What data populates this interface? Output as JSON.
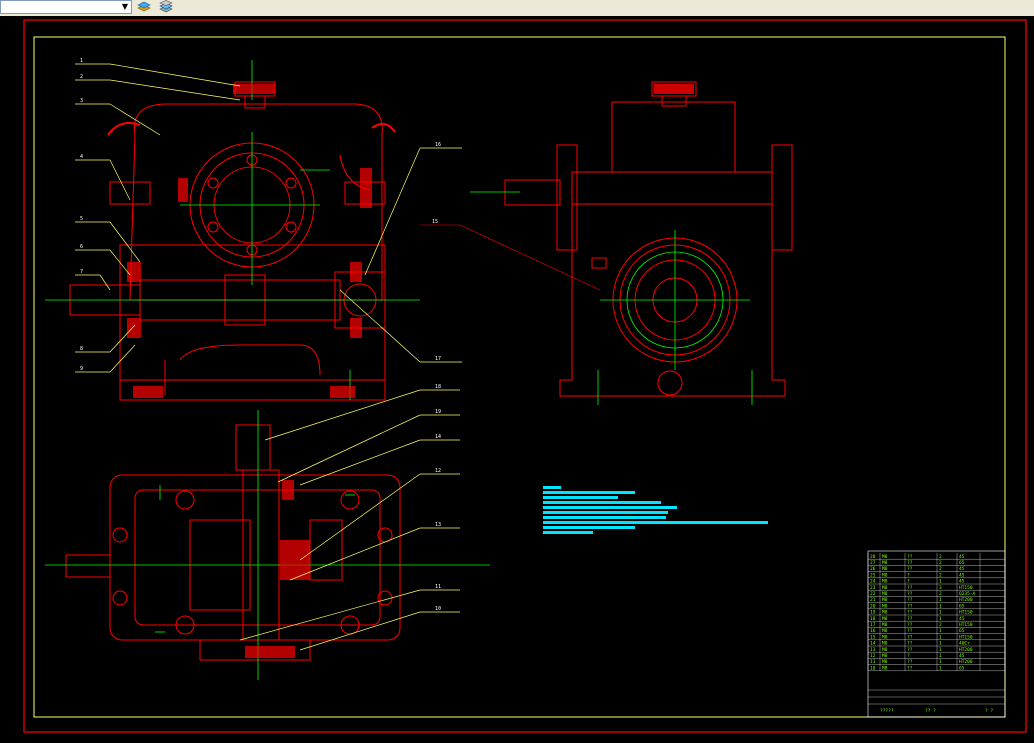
{
  "toolbar": {
    "layer_combo_value": "",
    "icons": [
      "layer-stack-icon",
      "layer-properties-icon"
    ]
  },
  "drawing": {
    "leaders_left": [
      "1",
      "2",
      "3",
      "4",
      "5",
      "6",
      "7",
      "8",
      "9"
    ],
    "leaders_right_top": [
      "16",
      "17"
    ],
    "leader_side_view": "15",
    "leaders_bottom": [
      "18",
      "19",
      "14",
      "12",
      "13",
      "11",
      "10"
    ],
    "colors": {
      "outline": "#ff0000",
      "leader": "#ffff00",
      "centerline": "#00ff00",
      "note": "#00ffff",
      "bom": "#7CFC00"
    }
  },
  "title_block": {
    "rows": [
      [
        "28",
        "M8",
        "??",
        "2",
        "45"
      ],
      [
        "27",
        "M8",
        "??",
        "2",
        "65"
      ],
      [
        "26",
        "M8",
        "??",
        "2",
        "45"
      ],
      [
        "25",
        "M8",
        "?",
        "2",
        "45"
      ],
      [
        "24",
        "M8",
        "?",
        "1",
        "45"
      ],
      [
        "23",
        "M8",
        "??",
        "3",
        "HT150"
      ],
      [
        "22",
        "M8",
        "??",
        "2",
        "Q235-A"
      ],
      [
        "21",
        "M8",
        "??",
        "1",
        "HT200"
      ],
      [
        "20",
        "M8",
        "??",
        "1",
        "65"
      ],
      [
        "19",
        "M8",
        "??",
        "1",
        "HT150"
      ],
      [
        "18",
        "M8",
        "??",
        "1",
        "45"
      ],
      [
        "17",
        "M8",
        "??",
        "2",
        "HT150"
      ],
      [
        "16",
        "M8",
        "??",
        "1",
        "65"
      ],
      [
        "15",
        "M8",
        "??",
        "1",
        "HT150"
      ],
      [
        "14",
        "M8",
        "??",
        "1",
        "40Cr"
      ],
      [
        "13",
        "M8",
        "??",
        "1",
        "HT200"
      ],
      [
        "12",
        "M8",
        "?",
        "1",
        "45"
      ],
      [
        "11",
        "M8",
        "??",
        "1",
        "HT200"
      ],
      [
        "10",
        "M8",
        "??",
        "1",
        "65"
      ]
    ],
    "footer_left": "?????",
    "footer_mid": "?? ?",
    "footer_right": "? ?"
  }
}
